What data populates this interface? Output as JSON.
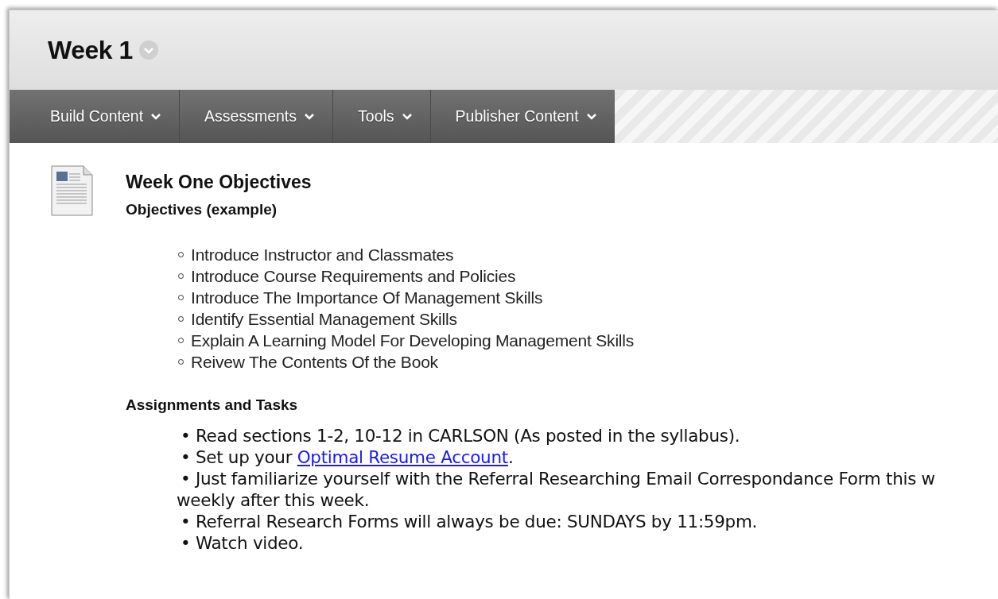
{
  "page": {
    "title": "Week 1"
  },
  "menu": [
    {
      "label": "Build Content"
    },
    {
      "label": "Assessments"
    },
    {
      "label": "Tools"
    },
    {
      "label": "Publisher Content"
    }
  ],
  "item": {
    "kind": "document",
    "title": "Week One Objectives",
    "sections": [
      {
        "heading": "Objectives (example)",
        "kind": "circles",
        "lines": [
          {
            "text": "Introduce Instructor and Classmates"
          },
          {
            "text": "Introduce Course Requirements and Policies"
          },
          {
            "text": "Introduce The Importance Of Management Skills"
          },
          {
            "text": "Identify Essential Management Skills"
          },
          {
            "text": "Explain A Learning Model For Developing Management Skills"
          },
          {
            "text": "Reivew The Contents Of the Book"
          }
        ]
      },
      {
        "heading": "Assignments and Tasks",
        "kind": "bullets",
        "lines": [
          {
            "text": "• Read sections 1-2, 10-12 in CARLSON (As posted in the syllabus)."
          },
          {
            "text": "• Set up your ",
            "link": "Optimal Resume Account",
            "after": "."
          },
          {
            "text": "• Just familiarize yourself with the Referral Researching Email Correspondance Form this w",
            "continuation": "weekly after this week."
          },
          {
            "text": "• Referral Research Forms will always be due: SUNDAYS by 11:59pm."
          },
          {
            "text": "• Watch video."
          }
        ]
      }
    ]
  }
}
